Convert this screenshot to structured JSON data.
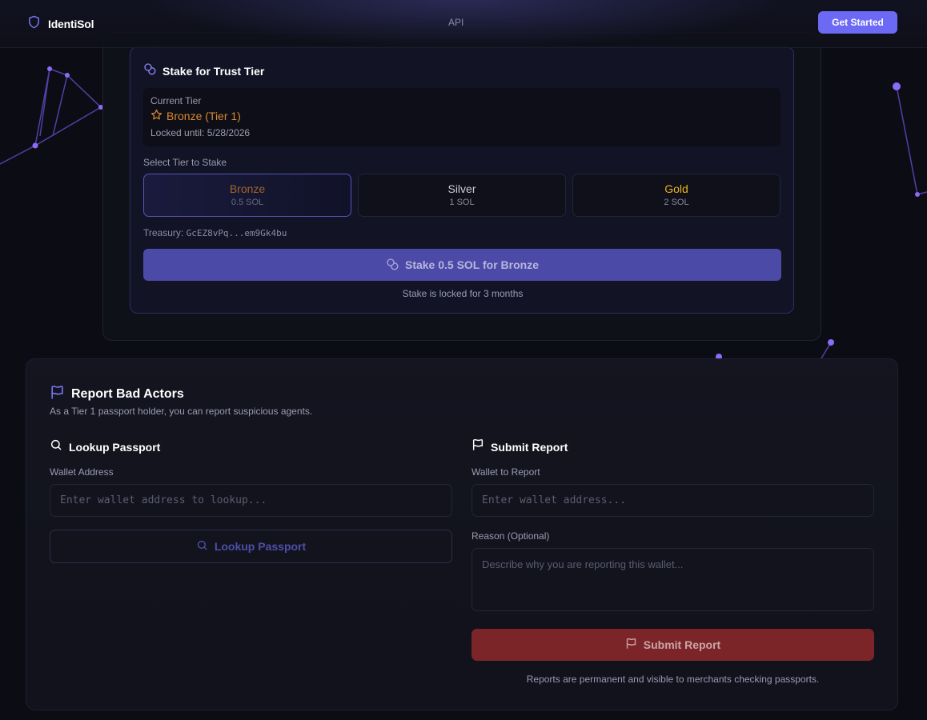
{
  "header": {
    "brand": "IdentiSol",
    "nav": {
      "api_label": "API"
    },
    "cta_label": "Get Started"
  },
  "stake": {
    "title": "Stake for Trust Tier",
    "current_tier_label": "Current Tier",
    "current_tier_value": "Bronze (Tier 1)",
    "locked_until": "Locked until: 5/28/2026",
    "select_label": "Select Tier to Stake",
    "tiers": [
      {
        "name": "Bronze",
        "price": "0.5 SOL",
        "color": "#a4642a",
        "selected": true
      },
      {
        "name": "Silver",
        "price": "1 SOL",
        "color": "#c9cad6",
        "selected": false
      },
      {
        "name": "Gold",
        "price": "2 SOL",
        "color": "#e8b422",
        "selected": false
      }
    ],
    "treasury_label": "Treasury:",
    "treasury_address": "GcEZ8vPq...em9Gk4bu",
    "button_label": "Stake 0.5 SOL for Bronze",
    "lock_note": "Stake is locked for 3 months"
  },
  "report": {
    "title": "Report Bad Actors",
    "subtitle": "As a Tier 1 passport holder, you can report suspicious agents.",
    "lookup": {
      "title": "Lookup Passport",
      "field_label": "Wallet Address",
      "placeholder": "Enter wallet address to lookup...",
      "button_label": "Lookup Passport"
    },
    "submit": {
      "title": "Submit Report",
      "wallet_label": "Wallet to Report",
      "wallet_placeholder": "Enter wallet address...",
      "reason_label": "Reason (Optional)",
      "reason_placeholder": "Describe why you are reporting this wallet...",
      "button_label": "Submit Report",
      "note": "Reports are permanent and visible to merchants checking passports."
    }
  },
  "colors": {
    "accent": "#6c6af4",
    "stake_button": "#4b4aa6",
    "danger": "#7c2529",
    "bronze": "#d8892e"
  },
  "icons": {
    "brand": "shield-icon",
    "stake": "coins-icon",
    "current_tier": "star-icon",
    "report": "flag-icon",
    "lookup": "search-icon"
  }
}
